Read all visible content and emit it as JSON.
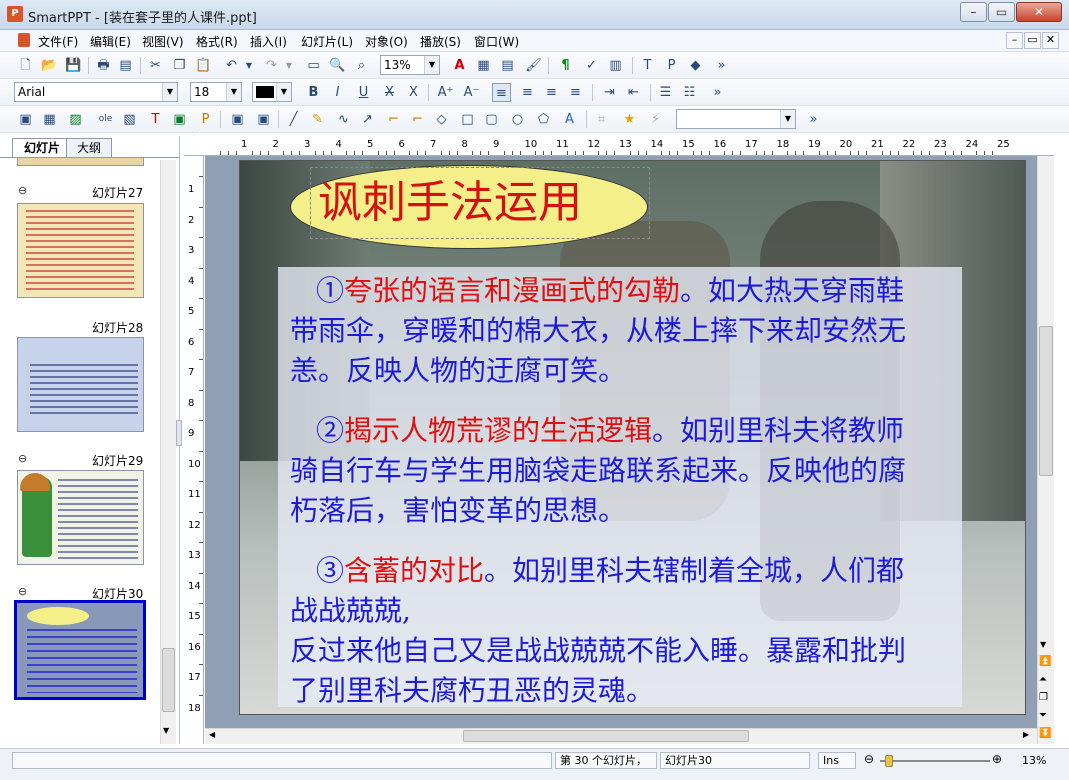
{
  "window": {
    "app_name": "SmartPPT",
    "title": "SmartPPT - [装在套子里的人课件.ppt]",
    "minimize": "–",
    "maximize": "▭",
    "close": "✕"
  },
  "menu": [
    "文件(F)",
    "编辑(E)",
    "视图(V)",
    "格式(R)",
    "插入(I)",
    "幻灯片(L)",
    "对象(O)",
    "播放(S)",
    "窗口(W)"
  ],
  "doc_controls": {
    "min": "–",
    "restore": "▭",
    "close": "✕"
  },
  "toolbar1": {
    "zoom": "13%",
    "more": "»"
  },
  "toolbar2": {
    "font": "Arial",
    "size": "18",
    "more": "»"
  },
  "toolbar3": {
    "more": "»"
  },
  "tabs": {
    "slides": "幻灯片",
    "outline": "大纲"
  },
  "thumbnails": [
    {
      "label": "幻灯片27",
      "selected": false
    },
    {
      "label": "幻灯片28",
      "selected": false
    },
    {
      "label": "幻灯片29",
      "selected": false
    },
    {
      "label": "幻灯片30",
      "selected": true
    }
  ],
  "ruler": {
    "h": [
      "1",
      "2",
      "3",
      "4",
      "5",
      "6",
      "7",
      "8",
      "9",
      "10",
      "11",
      "12",
      "13",
      "14",
      "15",
      "16",
      "17",
      "18",
      "19",
      "20",
      "21",
      "22",
      "23",
      "24",
      "25"
    ],
    "v": [
      "1",
      "2",
      "3",
      "4",
      "5",
      "6",
      "7",
      "8",
      "9",
      "10",
      "11",
      "12",
      "13",
      "14",
      "15",
      "16",
      "17",
      "18"
    ]
  },
  "slide": {
    "title": "讽刺手法运用",
    "p1": {
      "marker": "①",
      "red": "夸张的语言和漫画式的勾勒",
      "rest1": "。如大热天穿雨鞋",
      "line2": "带雨伞，穿暖和的棉大衣，从楼上摔下来却安然无",
      "line3": "恙。反映人物的迂腐可笑。"
    },
    "p2": {
      "marker": "②",
      "red": "揭示人物荒谬的生活逻辑",
      "rest1": "。如别里科夫将教师",
      "line2": "骑自行车与学生用脑袋走路联系起来。反映他的腐",
      "line3": "朽落后，害怕变革的思想。"
    },
    "p3": {
      "marker": "③",
      "red": "含蓄的对比",
      "rest1": "。如别里科夫辖制着全城，人们都",
      "line2": "战战兢兢,",
      "line3": "反过来他自己又是战战兢兢不能入睡。暴露和批判",
      "line4": "了别里科夫腐朽丑恶的灵魂。"
    }
  },
  "status": {
    "current": "第 30 个幻灯片，",
    "name": "幻灯片30",
    "ins": "Ins",
    "zoom": "13%"
  },
  "colors": {
    "title_bg": "#f5ef8a",
    "body_text": "#1c1cd8",
    "highlight": "#e11010",
    "selection": "#0000cc"
  }
}
